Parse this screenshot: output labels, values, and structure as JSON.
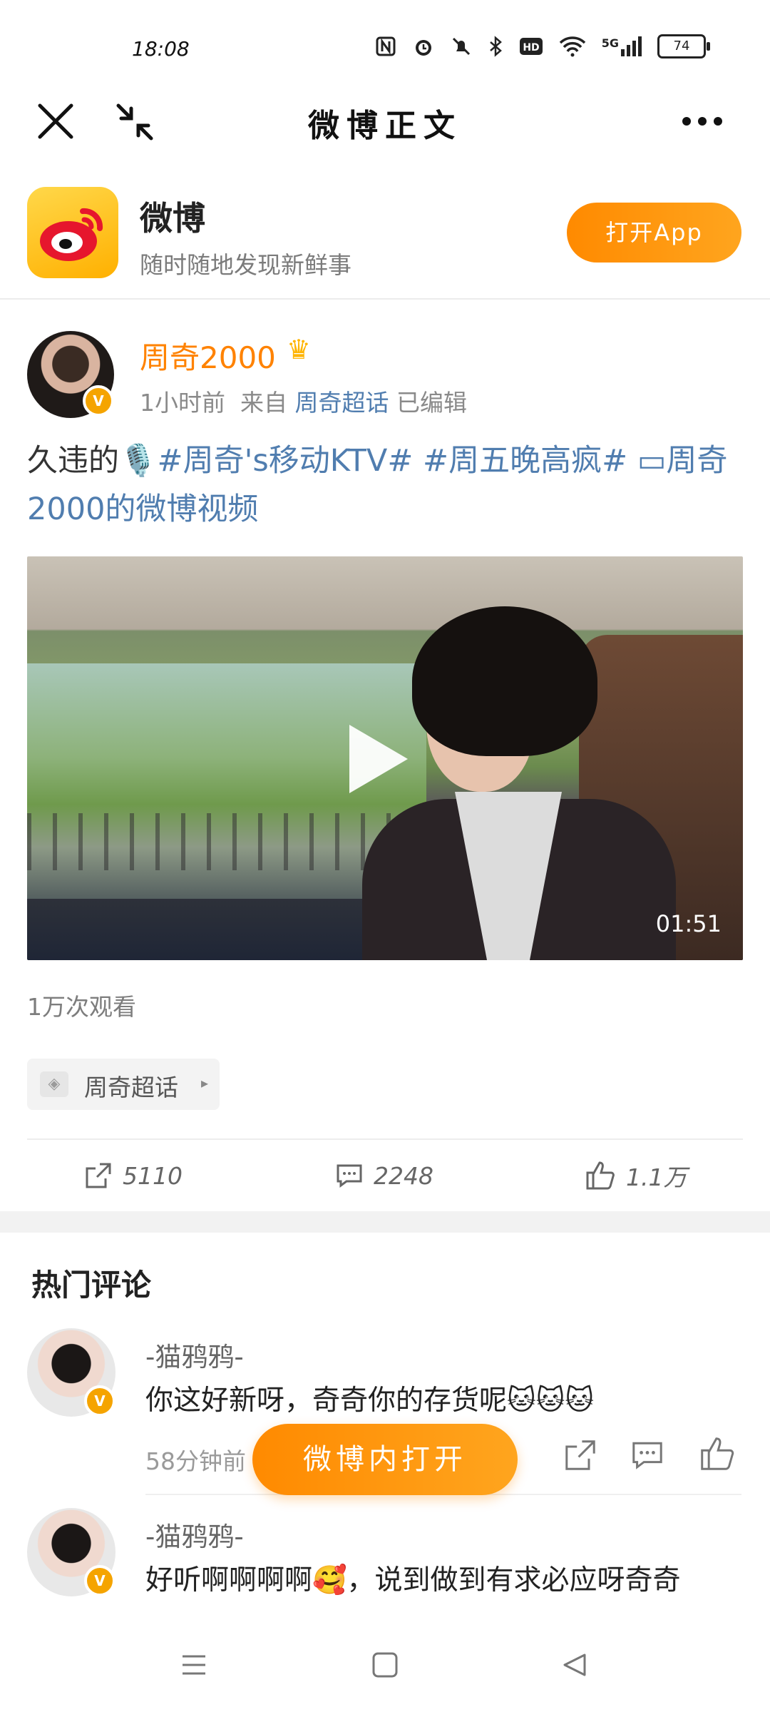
{
  "status_bar": {
    "time": "18:08",
    "network": "5G",
    "battery": "74"
  },
  "nav": {
    "title": "微博正文"
  },
  "app_banner": {
    "name": "微博",
    "tagline": "随时随地发现新鲜事",
    "open_label": "打开App"
  },
  "post": {
    "author": "周奇2000",
    "time": "1小时前",
    "source_prefix": "来自",
    "source": "周奇超话",
    "edited": "已编辑",
    "text_prefix": "久违的",
    "mic_emoji": "🎙️",
    "tag1": "#周奇's移动KTV#",
    "tag2": "#周五晚高疯#",
    "video_link_icon": "▭",
    "video_link": "周奇2000的微博视频",
    "video_duration": "01:51",
    "view_count": "1万次观看",
    "topic": "周奇超话",
    "reposts": "5110",
    "comments": "2248",
    "likes": "1.1万"
  },
  "comments_section": {
    "title": "热门评论",
    "items": [
      {
        "name": "-猫鸦鸦-",
        "text": "你这好新呀，奇奇你的存货呢🐱🐱🐱",
        "time": "58分钟前"
      },
      {
        "name": "-猫鸦鸦-",
        "text": "好听啊啊啊啊🥰，说到做到有求必应呀奇奇"
      }
    ]
  },
  "floating_button": {
    "label": "微博内打开"
  },
  "colors": {
    "accent": "#ff8200",
    "link": "#507daf",
    "button": "#ff9a10"
  }
}
